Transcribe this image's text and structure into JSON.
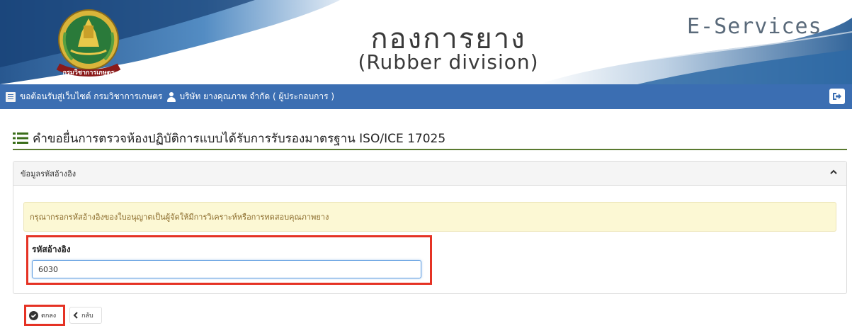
{
  "header": {
    "title_thai": "กองการยาง",
    "title_english": "(Rubber division)",
    "eservices": "E-Services",
    "logo_icon": "department-of-agriculture-emblem-icon",
    "logo_text": "กรมวิชาการเกษตร"
  },
  "navbar": {
    "welcome_text": "ขอต้อนรับสู่เว็บไซต์ กรมวิชาการเกษตร",
    "user_text": "บริษัท ยางคุณภาพ จำกัด ( ผู้ประกอบการ )",
    "menu_icon": "menu-icon",
    "user_icon": "user-icon",
    "logout_icon": "logout-icon",
    "background_color": "#3b6eb2"
  },
  "page": {
    "title": "คำขอยื่นการตรวจห้องปฏิบัติการแบบได้รับการรับรองมาตรฐาน ISO/ICE 17025",
    "title_icon": "list-icon"
  },
  "panel": {
    "header": "ข้อมูลรหัสอ้างอิง",
    "alert": "กรุณากรอกรหัสอ้างอิงของใบอนุญาตเป็นผู้จัดให้มีการวิเคราะห์หรือการทดสอบคุณภาพยาง",
    "field_label": "รหัสอ้างอิง",
    "field_value": "6030"
  },
  "buttons": {
    "ok_label": "ตกลง",
    "back_label": "กลับ"
  },
  "colors": {
    "accent_red": "#e53224",
    "heading_underline": "#5a7a30",
    "alert_bg": "#fcf8d4"
  }
}
